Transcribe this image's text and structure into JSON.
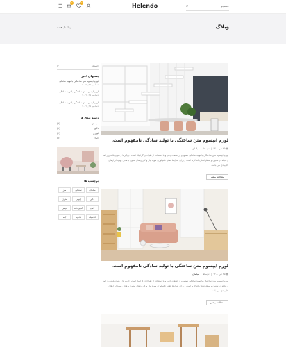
{
  "header": {
    "logo": "Helendo",
    "search_placeholder": "جستجو",
    "cart_count": "0",
    "wishlist_count": "0"
  },
  "banner": {
    "title": "وبلاگ",
    "breadcrumb_home": "خانه",
    "breadcrumb_sep": "/",
    "breadcrumb_current": "وبلاگ"
  },
  "sidebar": {
    "search_placeholder": "جستجو",
    "recent_title": "پستهای اخیر",
    "recent_posts": [
      {
        "title": "لورم ایپسوم متن ساختگی با تولید سادگی",
        "date": "دسامبر ۲۵, ۲۰۲۱"
      },
      {
        "title": "لورم ایپسوم متن ساختگی با تولید سادگی",
        "date": "دسامبر ۲۵, ۲۰۲۱"
      },
      {
        "title": "لورم ایپسوم متن ساختگی با تولید سادگی",
        "date": "دسامبر ۲۵, ۲۰۲۱"
      }
    ],
    "categories_title": "دسته بندی ها",
    "categories": [
      {
        "label": "مبلمان",
        "count": "(۲)"
      },
      {
        "label": "دکور",
        "count": "(۱)"
      },
      {
        "label": "لوازم",
        "count": "(۲)"
      },
      {
        "label": "چراغ",
        "count": "(۱)"
      }
    ],
    "tags_title": "برچسب ها",
    "tags": [
      "مبلمان",
      "صندلی",
      "میز",
      "دکور",
      "چوبی",
      "مدرن",
      "لامپ",
      "آشپزخانه",
      "فرش",
      "کلاسیک",
      "کاناپه",
      "آینه"
    ]
  },
  "posts": [
    {
      "title": "لورم ایپسوم متن ساختگی با تولید سادگی نامفهوم است.",
      "date": "۲۵ تیر ۱۴۰۰",
      "author": "توسط",
      "category": "مبلمان",
      "excerpt": "لورم ایپسوم متن ساختگی با تولید سادگی نامفهوم از صنعت چاپ و با استفاده از طراحان گرافیک است. چاپگرها و متون بلکه روزنامه و مجله در ستون و سطرآنچنان که لازم است و برای شرایط فعلی تکنولوژی مورد نیاز و کاربردهای متنوع با هدف بهبود ابزارهای کاربردی می باشد.",
      "button": "مطالعه بیشتر"
    },
    {
      "title": "لورم ایپسوم متن ساختگی با تولید سادگی نامفهوم است.",
      "date": "۲۵ تیر ۱۴۰۰",
      "author": "توسط",
      "category": "مبلمان",
      "excerpt": "لورم ایپسوم متن ساختگی با تولید سادگی نامفهوم از صنعت چاپ و با استفاده از طراحان گرافیک است. چاپگرها و متون بلکه روزنامه و مجله در ستون و سطرآنچنان که لازم است و برای شرایط فعلی تکنولوژی مورد نیاز و کاربردهای متنوع با هدف بهبود ابزارهای کاربردی می باشد.",
      "button": "مطالعه بیشتر"
    }
  ]
}
